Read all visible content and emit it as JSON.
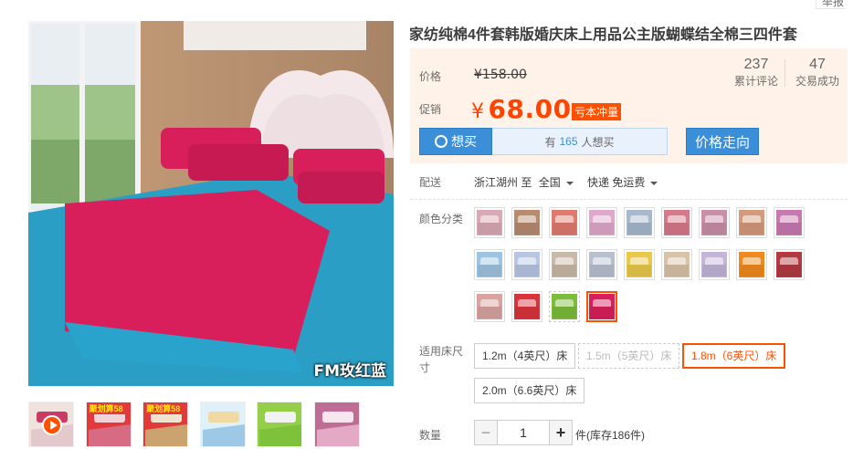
{
  "report_label": "举报",
  "title": "家纺纯棉4件套韩版婚庆床上用品公主版蝴蝶结全棉三四件套",
  "main_image": {
    "caption": "FM玫红蓝"
  },
  "thumbnails": [
    {
      "label": "",
      "has_play": true,
      "colors": [
        "#e4c9cc",
        "#c93a64",
        "#f0e3de"
      ]
    },
    {
      "label": "聚划算58",
      "has_play": false,
      "colors": [
        "#d86b84",
        "#f2d2d8",
        "#e23a3a"
      ]
    },
    {
      "label": "聚划算58",
      "has_play": false,
      "colors": [
        "#caa36f",
        "#efe2cf",
        "#e23a3a"
      ]
    },
    {
      "label": "",
      "has_play": false,
      "colors": [
        "#9dc9e6",
        "#f1d9a3",
        "#e0f0f8"
      ]
    },
    {
      "label": "",
      "has_play": false,
      "colors": [
        "#7dc23a",
        "#f2f2f2",
        "#95cf4a"
      ]
    },
    {
      "label": "",
      "has_play": false,
      "colors": [
        "#e3a9c5",
        "#f7e6ee",
        "#c06d95"
      ]
    }
  ],
  "price": {
    "label": "价格",
    "original": "¥158.00",
    "promo_label": "促销",
    "yen": "¥",
    "promo_value": "68.00",
    "badge": "亏本冲量"
  },
  "stats": [
    {
      "num": "237",
      "label": "累计评论"
    },
    {
      "num": "47",
      "label": "交易成功"
    }
  ],
  "want": {
    "button": "想买",
    "prefix": "有",
    "count": "165",
    "suffix": "人想买"
  },
  "trend_button": "价格走向",
  "shipping": {
    "label": "配送",
    "from": "浙江湖州 至",
    "to": "全国",
    "method": "快递 免运费"
  },
  "color_label": "颜色分类",
  "swatches": [
    {
      "color": "#d9a9b6",
      "state": "normal"
    },
    {
      "color": "#b88a70",
      "state": "normal"
    },
    {
      "color": "#e07a6e",
      "state": "normal"
    },
    {
      "color": "#e0a8cc",
      "state": "normal"
    },
    {
      "color": "#a8b9cf",
      "state": "normal"
    },
    {
      "color": "#d7798a",
      "state": "normal"
    },
    {
      "color": "#c98fa7",
      "state": "normal"
    },
    {
      "color": "#d59a7c",
      "state": "normal"
    },
    {
      "color": "#c879b0",
      "state": "normal"
    },
    {
      "color": "#9ec4e3",
      "state": "normal"
    },
    {
      "color": "#b7c6e4",
      "state": "normal"
    },
    {
      "color": "#c9b9a8",
      "state": "normal"
    },
    {
      "color": "#b8c0d0",
      "state": "normal"
    },
    {
      "color": "#e9c84a",
      "state": "normal"
    },
    {
      "color": "#d8c2a8",
      "state": "normal"
    },
    {
      "color": "#c3b6d9",
      "state": "normal"
    },
    {
      "color": "#f08a1e",
      "state": "normal"
    },
    {
      "color": "#b23a40",
      "state": "normal"
    },
    {
      "color": "#d9a3a0",
      "state": "normal"
    },
    {
      "color": "#d9343c",
      "state": "normal"
    },
    {
      "color": "#7cbd3a",
      "state": "dashed"
    },
    {
      "color": "#d81f5c",
      "state": "selected"
    }
  ],
  "size_label": "适用床尺寸",
  "sizes": [
    {
      "label": "1.2m（4英尺）床",
      "state": "normal"
    },
    {
      "label": "1.5m（5英尺）床",
      "state": "disabled"
    },
    {
      "label": "1.8m（6英尺）床",
      "state": "selected"
    },
    {
      "label": "2.0m（6.6英尺）床",
      "state": "normal"
    }
  ],
  "quantity": {
    "label": "数量",
    "value": "1",
    "minus": "−",
    "plus": "+",
    "stock": "件(库存186件)"
  }
}
